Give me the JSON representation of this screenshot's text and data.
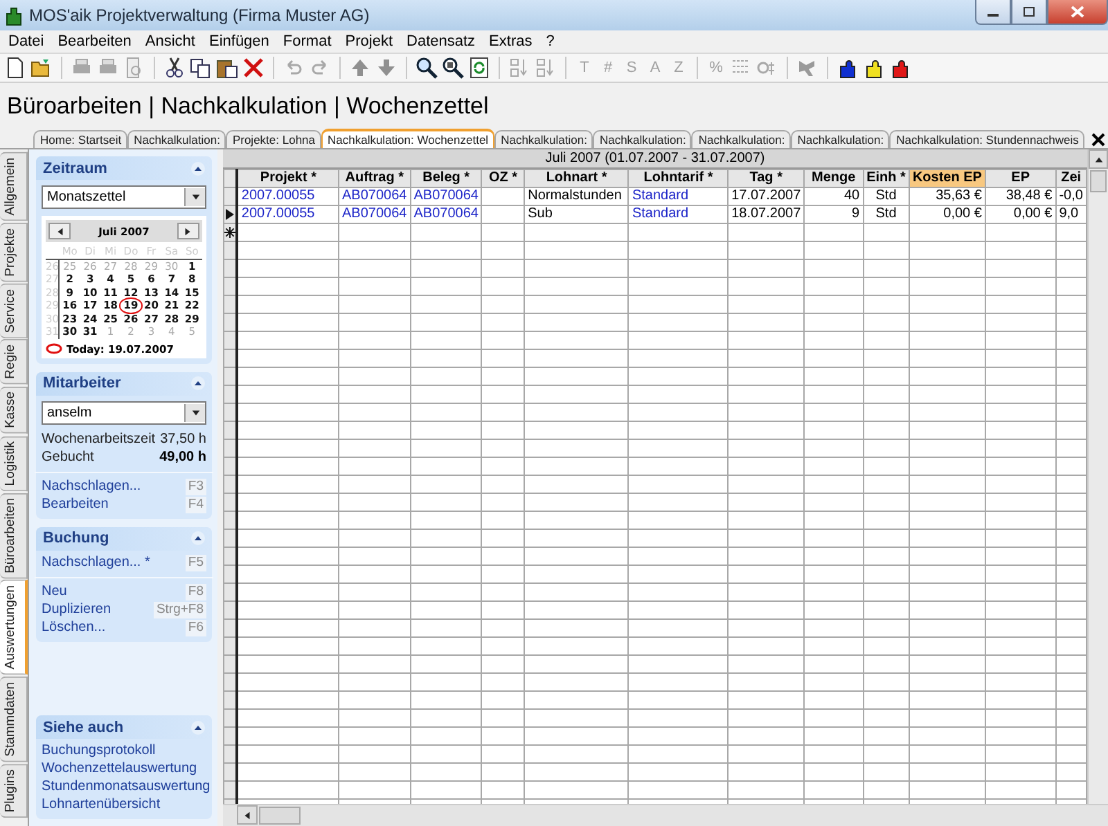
{
  "window": {
    "title": "MOS'aik Projektverwaltung (Firma Muster AG)"
  },
  "menu": [
    "Datei",
    "Bearbeiten",
    "Ansicht",
    "Einfügen",
    "Format",
    "Projekt",
    "Datensatz",
    "Extras",
    "?"
  ],
  "toolbar": {
    "letters": [
      "T",
      "#",
      "S",
      "A",
      "Z",
      "%"
    ]
  },
  "heading": "Büroarbeiten | Nachkalkulation | Wochenzettel",
  "doc_tabs": [
    {
      "label": "Home: Startseit",
      "selected": false
    },
    {
      "label": "Nachkalkulation:",
      "selected": false
    },
    {
      "label": "Projekte: Lohna",
      "selected": false
    },
    {
      "label": "Nachkalkulation: Wochenzettel",
      "selected": true
    },
    {
      "label": "Nachkalkulation:",
      "selected": false
    },
    {
      "label": "Nachkalkulation:",
      "selected": false
    },
    {
      "label": "Nachkalkulation:",
      "selected": false
    },
    {
      "label": "Nachkalkulation:",
      "selected": false
    },
    {
      "label": "Nachkalkulation: Stundennachweis",
      "selected": false
    }
  ],
  "side_tabs": [
    {
      "label": "Allgemein",
      "selected": false
    },
    {
      "label": "Projekte",
      "selected": false
    },
    {
      "label": "Service",
      "selected": false
    },
    {
      "label": "Regie",
      "selected": false
    },
    {
      "label": "Kasse",
      "selected": false
    },
    {
      "label": "Logistik",
      "selected": false
    },
    {
      "label": "Büroarbeiten",
      "selected": false
    },
    {
      "label": "Auswertungen",
      "selected": true
    },
    {
      "label": "Stammdaten",
      "selected": false
    },
    {
      "label": "Plugins",
      "selected": false
    }
  ],
  "sidebar": {
    "panels": [
      {
        "title": "Zeitraum",
        "expanded": true,
        "items": [
          {
            "kind": "dropdown",
            "value": "Monatszettel"
          },
          {
            "kind": "calendar",
            "month": "Juli 2007",
            "weekdays": [
              "Mo",
              "Di",
              "Mi",
              "Do",
              "Fr",
              "Sa",
              "So"
            ],
            "weeks": [
              {
                "number": "26",
                "days": [
                  {
                    "day": "25",
                    "other_month": true,
                    "today": false
                  },
                  {
                    "day": "26",
                    "other_month": true,
                    "today": false
                  },
                  {
                    "day": "27",
                    "other_month": true,
                    "today": false
                  },
                  {
                    "day": "28",
                    "other_month": true,
                    "today": false
                  },
                  {
                    "day": "29",
                    "other_month": true,
                    "today": false
                  },
                  {
                    "day": "30",
                    "other_month": true,
                    "today": false
                  },
                  {
                    "day": "1",
                    "other_month": false,
                    "today": false
                  }
                ]
              },
              {
                "number": "27",
                "days": [
                  {
                    "day": "2",
                    "other_month": false,
                    "today": false
                  },
                  {
                    "day": "3",
                    "other_month": false,
                    "today": false
                  },
                  {
                    "day": "4",
                    "other_month": false,
                    "today": false
                  },
                  {
                    "day": "5",
                    "other_month": false,
                    "today": false
                  },
                  {
                    "day": "6",
                    "other_month": false,
                    "today": false
                  },
                  {
                    "day": "7",
                    "other_month": false,
                    "today": false
                  },
                  {
                    "day": "8",
                    "other_month": false,
                    "today": false
                  }
                ]
              },
              {
                "number": "28",
                "days": [
                  {
                    "day": "9",
                    "other_month": false,
                    "today": false
                  },
                  {
                    "day": "10",
                    "other_month": false,
                    "today": false
                  },
                  {
                    "day": "11",
                    "other_month": false,
                    "today": false
                  },
                  {
                    "day": "12",
                    "other_month": false,
                    "today": false
                  },
                  {
                    "day": "13",
                    "other_month": false,
                    "today": false
                  },
                  {
                    "day": "14",
                    "other_month": false,
                    "today": false
                  },
                  {
                    "day": "15",
                    "other_month": false,
                    "today": false
                  }
                ]
              },
              {
                "number": "29",
                "days": [
                  {
                    "day": "16",
                    "other_month": false,
                    "today": false
                  },
                  {
                    "day": "17",
                    "other_month": false,
                    "today": false
                  },
                  {
                    "day": "18",
                    "other_month": false,
                    "today": false
                  },
                  {
                    "day": "19",
                    "other_month": false,
                    "today": true
                  },
                  {
                    "day": "20",
                    "other_month": false,
                    "today": false
                  },
                  {
                    "day": "21",
                    "other_month": false,
                    "today": false
                  },
                  {
                    "day": "22",
                    "other_month": false,
                    "today": false
                  }
                ]
              },
              {
                "number": "30",
                "days": [
                  {
                    "day": "23",
                    "other_month": false,
                    "today": false
                  },
                  {
                    "day": "24",
                    "other_month": false,
                    "today": false
                  },
                  {
                    "day": "25",
                    "other_month": false,
                    "today": false
                  },
                  {
                    "day": "26",
                    "other_month": false,
                    "today": false
                  },
                  {
                    "day": "27",
                    "other_month": false,
                    "today": false
                  },
                  {
                    "day": "28",
                    "other_month": false,
                    "today": false
                  },
                  {
                    "day": "29",
                    "other_month": false,
                    "today": false
                  }
                ]
              },
              {
                "number": "31",
                "days": [
                  {
                    "day": "30",
                    "other_month": false,
                    "today": false
                  },
                  {
                    "day": "31",
                    "other_month": false,
                    "today": false
                  },
                  {
                    "day": "1",
                    "other_month": true,
                    "today": false
                  },
                  {
                    "day": "2",
                    "other_month": true,
                    "today": false
                  },
                  {
                    "day": "3",
                    "other_month": true,
                    "today": false
                  },
                  {
                    "day": "4",
                    "other_month": true,
                    "today": false
                  },
                  {
                    "day": "5",
                    "other_month": true,
                    "today": false
                  }
                ]
              }
            ],
            "today_label": "Today: 19.07.2007"
          }
        ]
      },
      {
        "title": "Mitarbeiter",
        "expanded": true,
        "items": [
          {
            "kind": "dropdown",
            "value": "anselm"
          },
          {
            "kind": "stat",
            "label": "Wochenarbeitszeit",
            "value": "37,50 h",
            "bold": false
          },
          {
            "kind": "stat",
            "label": "Gebucht",
            "value": "49,00 h",
            "bold": true
          },
          {
            "kind": "separator"
          },
          {
            "kind": "link",
            "label": "Nachschlagen...",
            "shortcut": "F3"
          },
          {
            "kind": "link",
            "label": "Bearbeiten",
            "shortcut": "F4"
          }
        ]
      },
      {
        "title": "Buchung",
        "expanded": true,
        "items": [
          {
            "kind": "link",
            "label": "Nachschlagen... *",
            "shortcut": "F5"
          },
          {
            "kind": "separator"
          },
          {
            "kind": "link",
            "label": "Neu",
            "shortcut": "F8"
          },
          {
            "kind": "link",
            "label": "Duplizieren",
            "shortcut": "Strg+F8"
          },
          {
            "kind": "link",
            "label": "Löschen...",
            "shortcut": "F6"
          }
        ]
      },
      {
        "title": "Siehe auch",
        "expanded": true,
        "items": [
          {
            "kind": "link",
            "label": "Buchungsprotokoll"
          },
          {
            "kind": "link",
            "label": "Wochenzettelauswertung"
          },
          {
            "kind": "link",
            "label": "Stundenmonatsauswertung"
          },
          {
            "kind": "link",
            "label": "Lohnartenübersicht"
          }
        ]
      }
    ]
  },
  "grid": {
    "period": "Juli 2007 (01.07.2007 - 31.07.2007)",
    "columns": [
      {
        "label": "Projekt *",
        "kind": "link",
        "selected": false
      },
      {
        "label": "Auftrag *",
        "kind": "link",
        "selected": false
      },
      {
        "label": "Beleg *",
        "kind": "link",
        "selected": false
      },
      {
        "label": "OZ *",
        "kind": "text",
        "selected": false
      },
      {
        "label": "Lohnart *",
        "kind": "text",
        "selected": false
      },
      {
        "label": "Lohntarif *",
        "kind": "link",
        "selected": false
      },
      {
        "label": "Tag *",
        "kind": "text",
        "selected": false
      },
      {
        "label": "Menge",
        "kind": "number",
        "selected": false
      },
      {
        "label": "Einh *",
        "kind": "center",
        "selected": false
      },
      {
        "label": "Kosten EP",
        "kind": "number",
        "selected": true
      },
      {
        "label": "EP",
        "kind": "number",
        "selected": false
      },
      {
        "label": "Zei",
        "kind": "text",
        "selected": false
      }
    ],
    "rows": [
      {
        "current": false,
        "cells": [
          "2007.00055",
          "AB070064",
          "AB070064",
          "",
          "Normalstunden",
          "Standard",
          "17.07.2007",
          "40",
          "Std",
          "35,63 €",
          "38,48 €",
          "-0,0"
        ]
      },
      {
        "current": true,
        "cells": [
          "2007.00055",
          "AB070064",
          "AB070064",
          "",
          "Sub",
          "Standard",
          "18.07.2007",
          "9",
          "Std",
          "0,00 €",
          "0,00 €",
          "9,0"
        ]
      }
    ]
  }
}
